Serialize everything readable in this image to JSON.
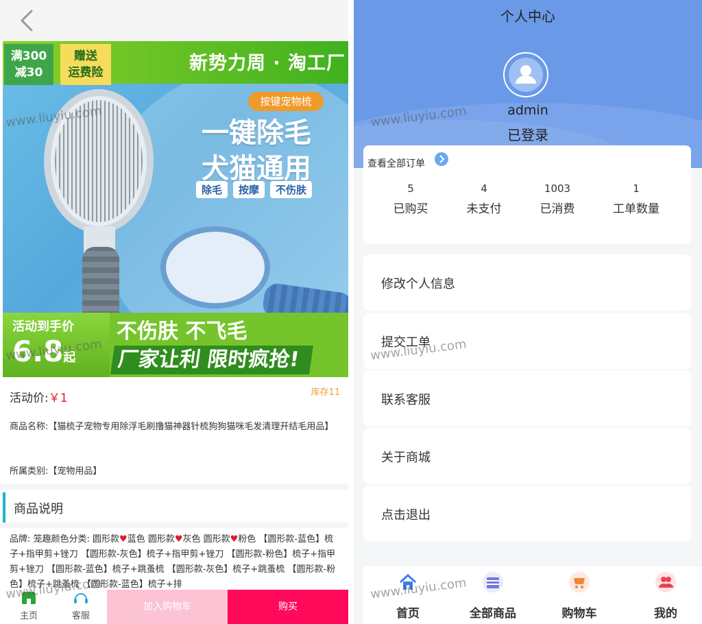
{
  "left": {
    "banner": {
      "promo_line1": "满300",
      "promo_line2": "减30",
      "badge_line1": "赠送",
      "badge_line2": "运费险",
      "brand": "新势力周 · 淘工厂",
      "tag": "按键宠物梳",
      "headline_1": "一键除毛",
      "headline_2": "犬猫通用",
      "chips": [
        "除毛",
        "按摩",
        "不伤肤"
      ],
      "bottom_label": "活动到手价",
      "bottom_price": "6.8",
      "bottom_unit": "起",
      "bottom_slogan_1": "不伤肤 不飞毛",
      "bottom_slogan_2": "厂家让利 限时疯抢!"
    },
    "price_label": "活动价:",
    "price_value": "￥1",
    "stock": "库存11",
    "name_text": "商品名称:【猫梳子宠物专用除浮毛刷撸猫神器针梳狗狗猫咪毛发清理开结毛用品】",
    "category_text": "所属类别:【宠物用品】",
    "section_title": "商品说明",
    "desc": {
      "p1": "品牌: 笼趣颜色分类: 圆形款",
      "p2": "蓝色 圆形款",
      "p3": "灰色 圆形款",
      "p4": "粉色 【圆形款-蓝色】梳子+指甲剪+锉刀 【圆形款-灰色】梳子+指甲剪+锉刀 【圆形款-粉色】梳子+指甲剪+锉刀 【圆形款-蓝色】梳子+跳蚤梳 【圆形款-灰色】梳子+跳蚤梳 【圆形款-粉色】梳子+跳蚤梳 【圆形款-蓝色】梳子+排"
    },
    "bottom": {
      "home_label": "主页",
      "cs_label": "客服",
      "cart_button": "加入购物车",
      "buy_button": "购买"
    }
  },
  "right": {
    "title": "个人中心",
    "username": "admin",
    "status": "已登录",
    "orders_link": "查看全部订单",
    "stats": [
      {
        "value": "5",
        "label": "已购买"
      },
      {
        "value": "4",
        "label": "未支付"
      },
      {
        "value": "1003",
        "label": "已消费"
      },
      {
        "value": "1",
        "label": "工单数量"
      }
    ],
    "menu": [
      "修改个人信息",
      "提交工单",
      "联系客服",
      "关于商城",
      "点击退出"
    ],
    "tabs": [
      "首页",
      "全部商品",
      "购物车",
      "我的"
    ]
  },
  "watermark": "www.liuyiu.com",
  "colors": {
    "hero_blue": "#6a99e8",
    "buy_button": "#ff0a5b",
    "cart_button": "#fcc3d4",
    "price_red": "#e02020",
    "stock_orange": "#f0a030",
    "section_accent": "#19b8c8"
  }
}
